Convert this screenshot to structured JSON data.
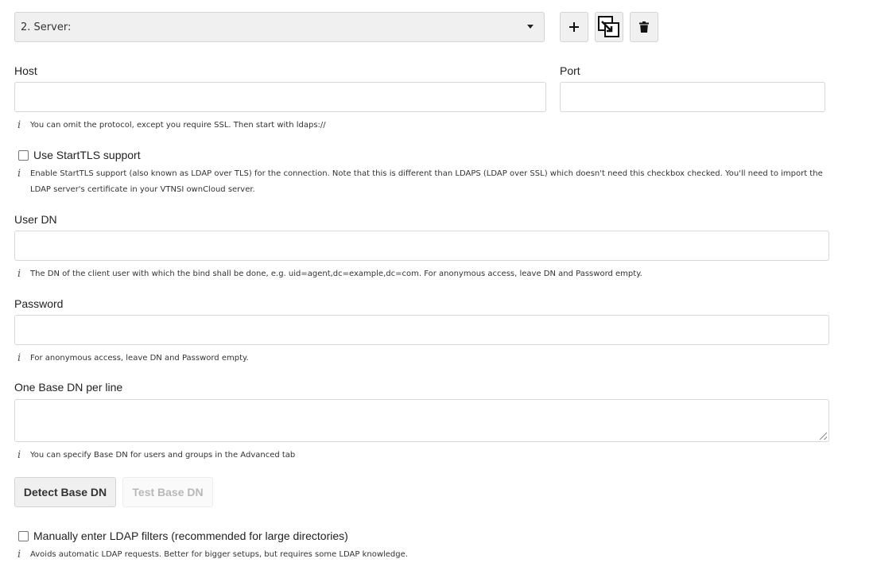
{
  "server": {
    "selected": "2. Server:",
    "add_icon": "plus-icon",
    "copy_icon": "copy-config-icon",
    "delete_icon": "trash-icon"
  },
  "host": {
    "label": "Host",
    "value": "",
    "hint": "You can omit the protocol, except you require SSL. Then start with ldaps://"
  },
  "port": {
    "label": "Port",
    "value": ""
  },
  "starttls": {
    "label": "Use StartTLS support",
    "checked": false,
    "hint": "Enable StartTLS support (also known as LDAP over TLS) for the connection. Note that this is different than LDAPS (LDAP over SSL) which doesn't need this checkbox checked. You'll need to import the LDAP server's certificate in your VTNSI ownCloud server."
  },
  "user_dn": {
    "label": "User DN",
    "value": "",
    "hint": "The DN of the client user with which the bind shall be done, e.g. uid=agent,dc=example,dc=com. For anonymous access, leave DN and Password empty."
  },
  "password": {
    "label": "Password",
    "value": "",
    "hint": "For anonymous access, leave DN and Password empty."
  },
  "base_dn": {
    "label": "One Base DN per line",
    "value": "",
    "hint": "You can specify Base DN for users and groups in the Advanced tab"
  },
  "buttons": {
    "detect": "Detect Base DN",
    "test": "Test Base DN"
  },
  "manual_filters": {
    "label": "Manually enter LDAP filters (recommended for large directories)",
    "checked": false,
    "hint": "Avoids automatic LDAP requests. Better for bigger setups, but requires some LDAP knowledge."
  },
  "info_glyph": "i"
}
